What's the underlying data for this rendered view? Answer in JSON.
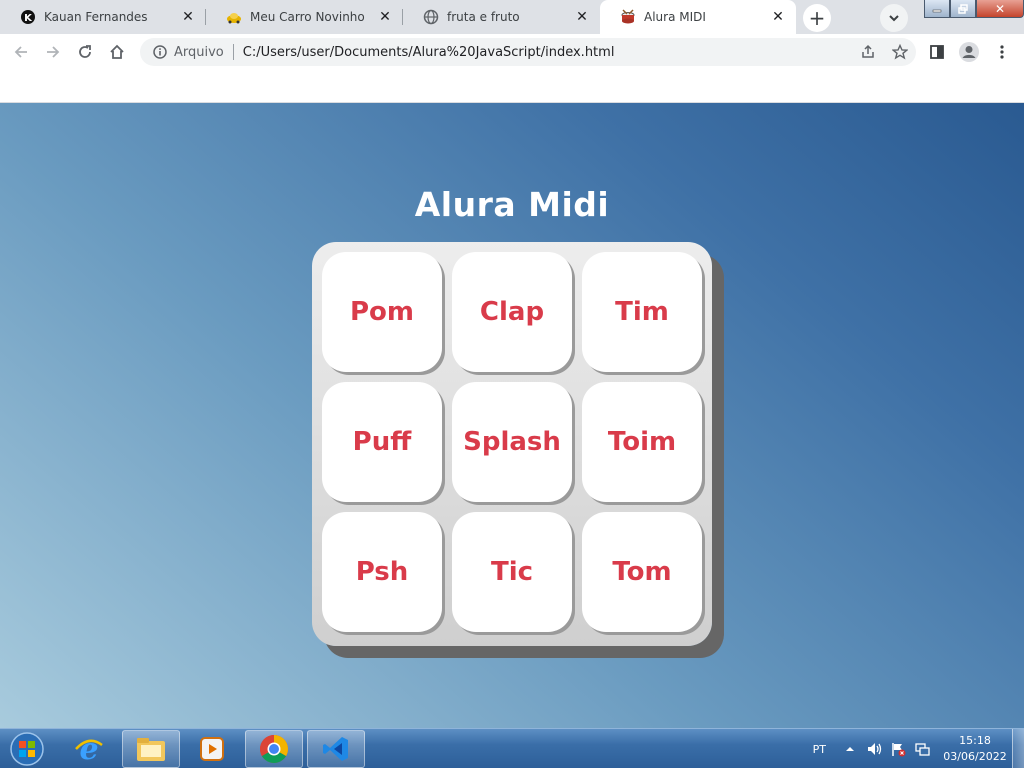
{
  "browser": {
    "tabs": [
      {
        "title": "Kauan Fernandes",
        "icon": "kauan-k-icon",
        "active": false
      },
      {
        "title": "Meu Carro Novinho",
        "icon": "car-icon",
        "active": false
      },
      {
        "title": "fruta e fruto",
        "icon": "globe-icon",
        "active": false
      },
      {
        "title": "Alura MIDI",
        "icon": "drum-icon",
        "active": true
      }
    ],
    "address": {
      "protocol_label": "Arquivo",
      "url": "C:/Users/user/Documents/Alura%20JavaScript/index.html"
    }
  },
  "page": {
    "title": "Alura Midi",
    "keys": [
      "Pom",
      "Clap",
      "Tim",
      "Puff",
      "Splash",
      "Toim",
      "Psh",
      "Tic",
      "Tom"
    ],
    "colors": {
      "key_text": "#d93b4a",
      "background_light": "#a8cbdd",
      "background_dark": "#2a5a91"
    }
  },
  "taskbar": {
    "language": "PT",
    "time": "15:18",
    "date": "03/06/2022",
    "apps": [
      "internet-explorer-icon",
      "file-explorer-icon",
      "media-player-icon",
      "chrome-icon",
      "vscode-icon"
    ]
  }
}
